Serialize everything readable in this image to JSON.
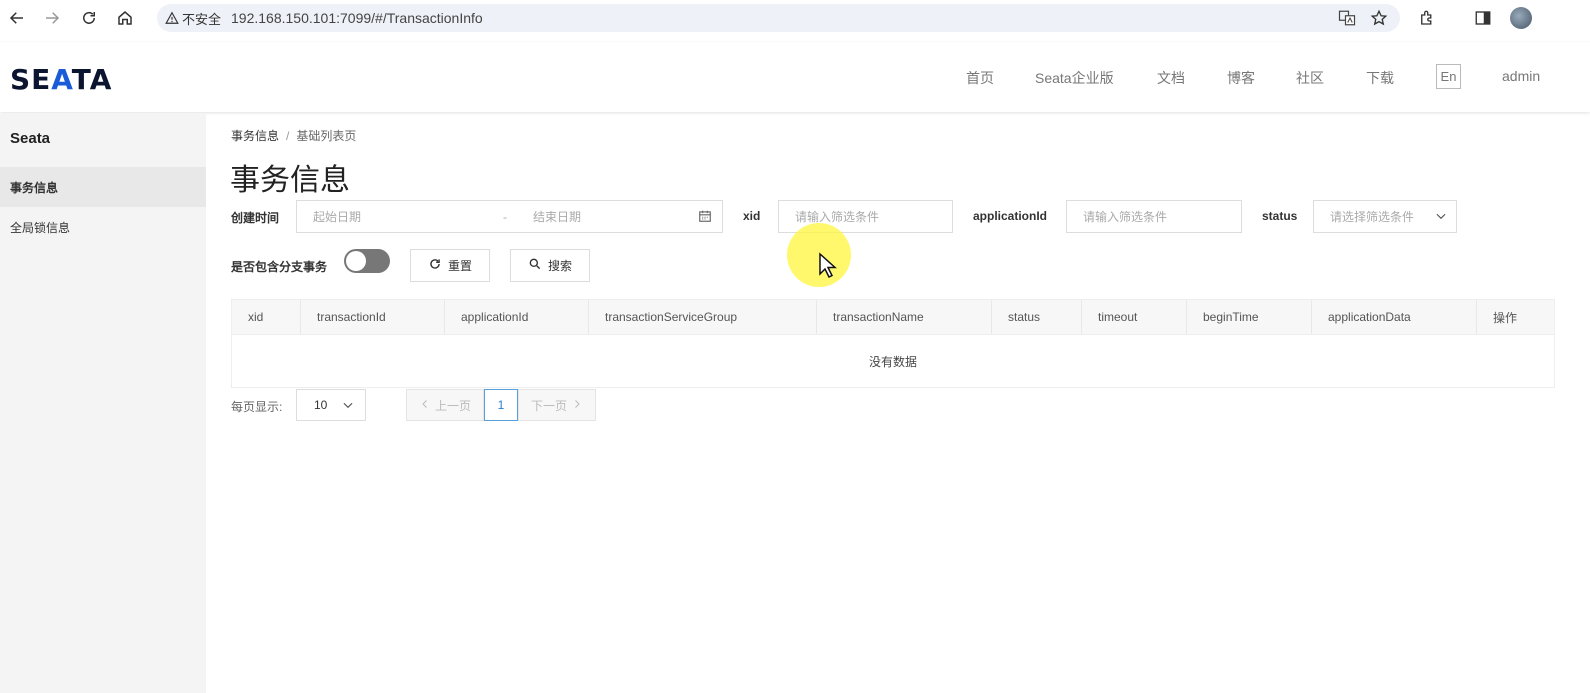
{
  "browser": {
    "security_label": "不安全",
    "url": "192.168.150.101:7099/#/TransactionInfo"
  },
  "header": {
    "logo_part1": "SE",
    "logo_part2": "A",
    "logo_part3": "TA",
    "nav": [
      "首页",
      "Seata企业版",
      "文档",
      "博客",
      "社区",
      "下载"
    ],
    "lang": "En",
    "user": "admin"
  },
  "sidebar": {
    "title": "Seata",
    "items": [
      {
        "label": "事务信息"
      },
      {
        "label": "全局锁信息"
      }
    ]
  },
  "breadcrumb": {
    "first": "事务信息",
    "separator": "/",
    "second": "基础列表页"
  },
  "page_title": "事务信息",
  "filters": {
    "create_time_label": "创建时间",
    "start_date_placeholder": "起始日期",
    "range_separator": "-",
    "end_date_placeholder": "结束日期",
    "xid_label": "xid",
    "xid_placeholder": "请输入筛选条件",
    "app_label": "applicationId",
    "app_placeholder": "请输入筛选条件",
    "status_label": "status",
    "status_placeholder": "请选择筛选条件",
    "branch_label": "是否包含分支事务",
    "reset_label": "重置",
    "search_label": "搜索"
  },
  "table": {
    "columns": [
      "xid",
      "transactionId",
      "applicationId",
      "transactionServiceGroup",
      "transactionName",
      "status",
      "timeout",
      "beginTime",
      "applicationData",
      "操作"
    ],
    "empty_text": "没有数据"
  },
  "pagination": {
    "page_size_label": "每页显示:",
    "page_size": "10",
    "prev_label": "上一页",
    "current_page": "1",
    "next_label": "下一页"
  }
}
